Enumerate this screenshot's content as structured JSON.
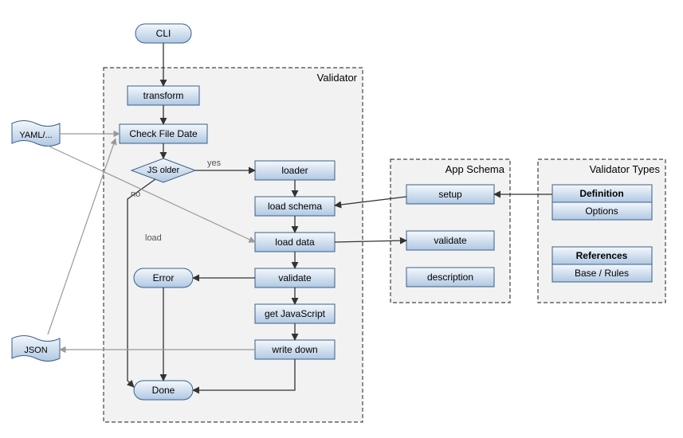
{
  "terminals": {
    "cli": "CLI",
    "error": "Error",
    "done": "Done"
  },
  "validator": {
    "title": "Validator",
    "nodes": {
      "transform": "transform",
      "checkFileDate": "Check File Date",
      "jsOlder": "JS older",
      "loader": "loader",
      "loadSchema": "load schema",
      "loadData": "load data",
      "validate": "validate",
      "getJS": "get JavaScript",
      "writeDown": "write down"
    }
  },
  "appSchema": {
    "title": "App Schema",
    "nodes": {
      "setup": "setup",
      "validate": "validate",
      "description": "description"
    }
  },
  "validatorTypes": {
    "title": "Validator Types",
    "definition": "Definition",
    "options": "Options",
    "references": "References",
    "baseRules": "Base / Rules"
  },
  "external": {
    "yaml": "YAML/...",
    "json": "JSON"
  },
  "edgeLabels": {
    "yes": "yes",
    "no": "no",
    "load": "load"
  }
}
